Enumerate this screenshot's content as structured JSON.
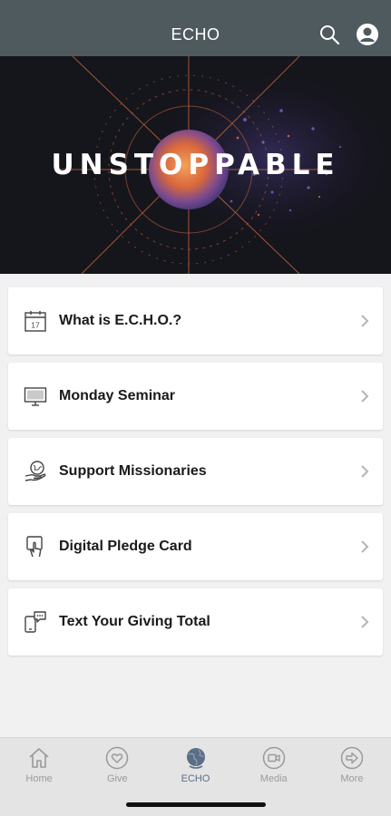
{
  "header": {
    "title": "ECHO",
    "search_icon": "search-icon",
    "profile_icon": "profile-icon"
  },
  "hero": {
    "title": "UNSTOPPABLE"
  },
  "menu": {
    "items": [
      {
        "label": "What is E.C.H.O.?",
        "icon": "calendar-icon"
      },
      {
        "label": "Monday Seminar",
        "icon": "monitor-icon"
      },
      {
        "label": "Support Missionaries",
        "icon": "globe-hand-icon"
      },
      {
        "label": "Digital Pledge Card",
        "icon": "touch-card-icon"
      },
      {
        "label": "Text Your Giving Total",
        "icon": "phone-message-icon"
      }
    ],
    "calendar_day": "17"
  },
  "tabs": {
    "items": [
      {
        "label": "Home",
        "icon": "home-icon",
        "active": false
      },
      {
        "label": "Give",
        "icon": "heart-icon",
        "active": false
      },
      {
        "label": "ECHO",
        "icon": "globe-icon",
        "active": true
      },
      {
        "label": "Media",
        "icon": "video-icon",
        "active": false
      },
      {
        "label": "More",
        "icon": "arrow-right-icon",
        "active": false
      }
    ]
  },
  "colors": {
    "header_bg": "#4f5a5f",
    "hero_bg": "#15151c",
    "hero_accent": "#e07a3a",
    "active_tab": "#5a6e86"
  }
}
